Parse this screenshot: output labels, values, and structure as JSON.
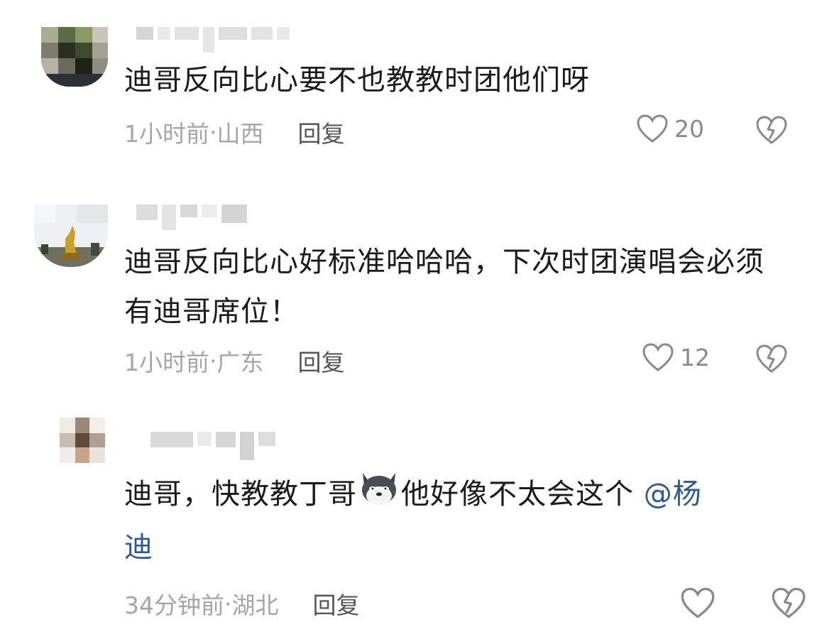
{
  "comments": [
    {
      "text": "迪哥反向比心要不也教教时团他们呀",
      "time": "1小时前",
      "location": "山西",
      "reply_label": "回复",
      "likes": "20"
    },
    {
      "text_line1": "迪哥反向比心好标准哈哈哈，下次时团演唱会必须",
      "text_line2": "有迪哥席位！",
      "time": "1小时前",
      "location": "广东",
      "reply_label": "回复",
      "likes": "12"
    },
    {
      "text_part1": "迪哥，快教教丁哥",
      "emoji": "wolf-emoji",
      "text_part2": "他好像不太会这个",
      "mention_line1": "@杨",
      "mention_line2": "迪",
      "time": "34分钟前",
      "location": "湖北",
      "reply_label": "回复",
      "likes": ""
    }
  ],
  "separator": " · ",
  "icons": {
    "like": "heart-outline-icon",
    "dislike": "broken-heart-icon"
  },
  "colors": {
    "text": "#1b1b1b",
    "meta": "#a6a6a6",
    "reply": "#555555",
    "mention": "#2f5a91",
    "icon": "#8a8a8a"
  }
}
